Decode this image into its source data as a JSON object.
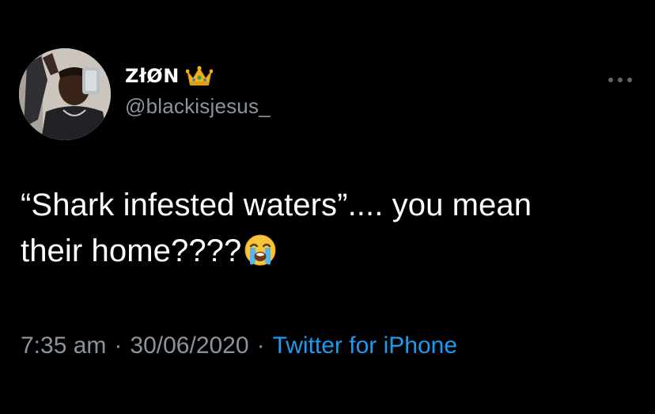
{
  "author": {
    "display_name": "ZłØN",
    "handle": "@blackisjesus_",
    "avatar_icon": "profile-photo",
    "badge_icon": "crown-icon"
  },
  "tweet": {
    "text_line1": "“Shark infested waters”.... you mean",
    "text_line2": "their home????",
    "emoji": "loudly-crying-face-icon"
  },
  "meta": {
    "time": "7:35 am",
    "separator": "·",
    "date": "30/06/2020",
    "source": "Twitter for iPhone"
  },
  "menu": {
    "icon": "more-horizontal-icon"
  },
  "colors": {
    "background": "#000000",
    "text_primary": "#ffffff",
    "text_secondary": "#8b949e",
    "link": "#1d9bf0"
  }
}
